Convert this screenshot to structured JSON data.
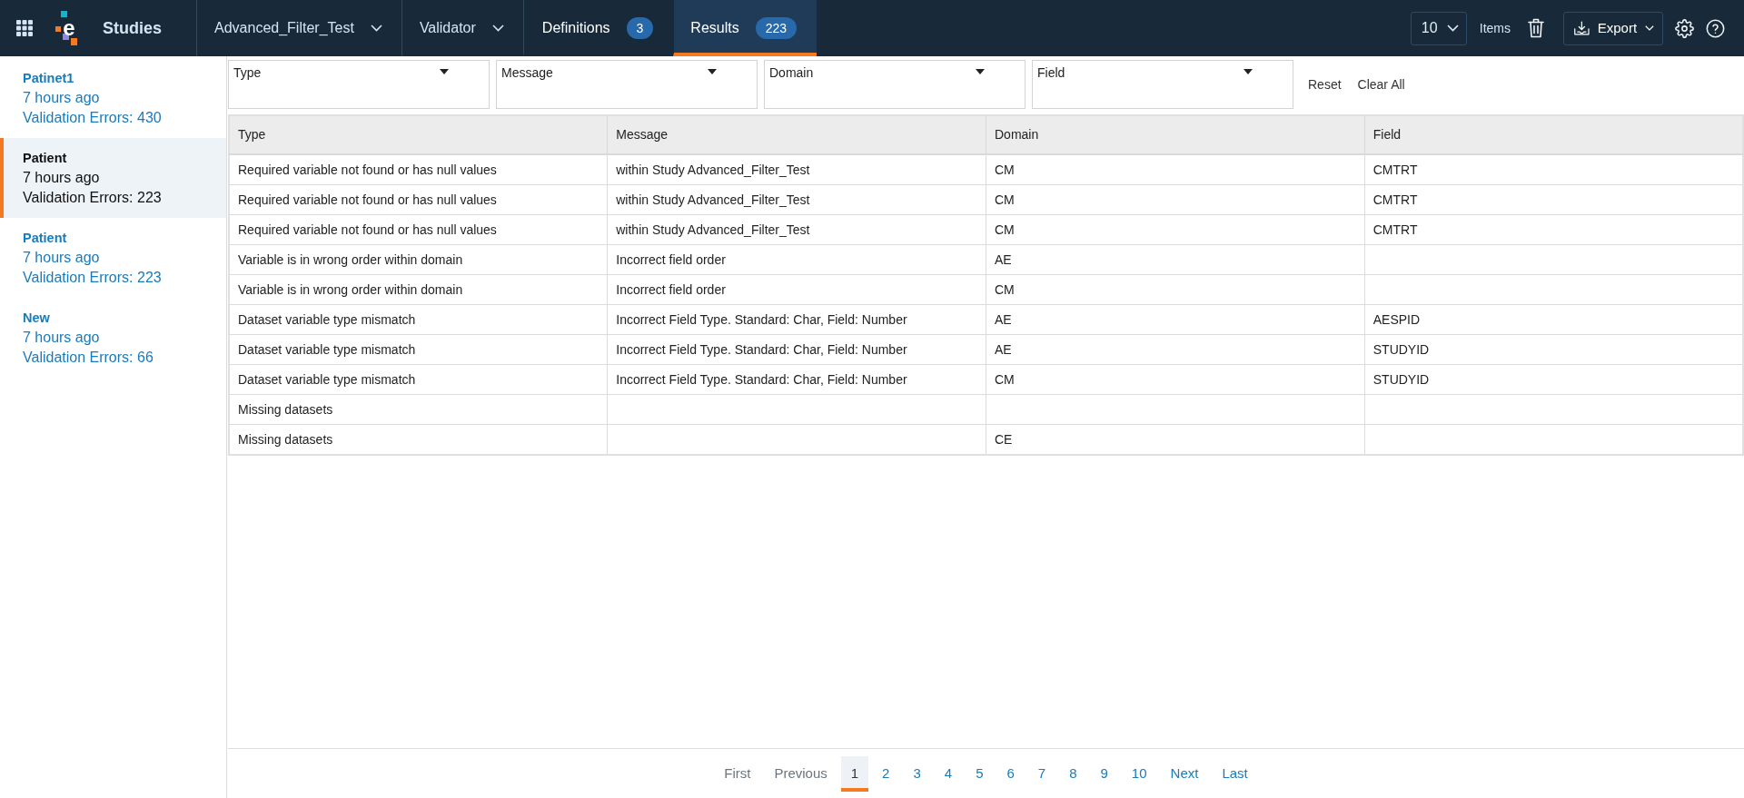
{
  "app_bar": {
    "logo": "e",
    "title": "Studies",
    "selectors": [
      {
        "label": "Advanced_Filter_Test"
      },
      {
        "label": "Validator"
      }
    ],
    "tabs": [
      {
        "label": "Definitions",
        "count": "3",
        "selected": false
      },
      {
        "label": "Results",
        "count": "223",
        "selected": true
      }
    ],
    "page_size": "10",
    "page_size_label": "Items",
    "export_button": "Export"
  },
  "sidebar": {
    "items": [
      {
        "name": "Patinet1",
        "time": "7 hours ago",
        "errors": "Validation Errors: 430",
        "selected": false
      },
      {
        "name": "Patient",
        "time": "7 hours ago",
        "errors": "Validation Errors: 223",
        "selected": true
      },
      {
        "name": "Patient",
        "time": "7 hours ago",
        "errors": "Validation Errors: 223",
        "selected": false
      },
      {
        "name": "New",
        "time": "7 hours ago",
        "errors": "Validation Errors: 66",
        "selected": false
      }
    ]
  },
  "filters": {
    "fields": [
      {
        "label": "Type"
      },
      {
        "label": "Message"
      },
      {
        "label": "Domain"
      },
      {
        "label": "Field"
      }
    ],
    "actions": [
      "Reset",
      "Clear All"
    ]
  },
  "table": {
    "columns": [
      "Type",
      "Message",
      "Domain",
      "Field"
    ],
    "rows": [
      {
        "type": "Required variable not found or has null values",
        "message": "within Study Advanced_Filter_Test",
        "domain": "CM",
        "field": "CMTRT"
      },
      {
        "type": "Required variable not found or has null values",
        "message": "within Study Advanced_Filter_Test",
        "domain": "CM",
        "field": "CMTRT"
      },
      {
        "type": "Required variable not found or has null values",
        "message": "within Study Advanced_Filter_Test",
        "domain": "CM",
        "field": "CMTRT"
      },
      {
        "type": "Variable is in wrong order within domain",
        "message": "Incorrect field order",
        "domain": "AE"
      },
      {
        "type": "Variable is in wrong order within domain",
        "message": "Incorrect field order",
        "domain": "CM"
      },
      {
        "type": "Dataset variable type mismatch",
        "message": "Incorrect Field Type. Standard: Char, Field: Number",
        "domain": "AE",
        "field": "AESPID"
      },
      {
        "type": "Dataset variable type mismatch",
        "message": "Incorrect Field Type. Standard: Char, Field: Number",
        "domain": "AE",
        "field": "STUDYID"
      },
      {
        "type": "Dataset variable type mismatch",
        "message": "Incorrect Field Type. Standard: Char, Field: Number",
        "domain": "CM",
        "field": "STUDYID"
      },
      {
        "type": "Missing datasets"
      },
      {
        "type": "Missing datasets",
        "domain": "CE"
      }
    ]
  },
  "pagination": {
    "items": [
      {
        "label": "First",
        "selected": false,
        "disabled": true
      },
      {
        "label": "Previous",
        "selected": false,
        "disabled": true
      },
      {
        "label": "1",
        "selected": true,
        "disabled": false
      },
      {
        "label": "2",
        "selected": false,
        "disabled": false
      },
      {
        "label": "3",
        "selected": false,
        "disabled": false
      },
      {
        "label": "4",
        "selected": false,
        "disabled": false
      },
      {
        "label": "5",
        "selected": false,
        "disabled": false
      },
      {
        "label": "6",
        "selected": false,
        "disabled": false
      },
      {
        "label": "7",
        "selected": false,
        "disabled": false
      },
      {
        "label": "8",
        "selected": false,
        "disabled": false
      },
      {
        "label": "9",
        "selected": false,
        "disabled": false
      },
      {
        "label": "10",
        "selected": false,
        "disabled": false
      },
      {
        "label": "Next",
        "selected": false,
        "disabled": false
      },
      {
        "label": "Last",
        "selected": false,
        "disabled": false
      }
    ]
  }
}
